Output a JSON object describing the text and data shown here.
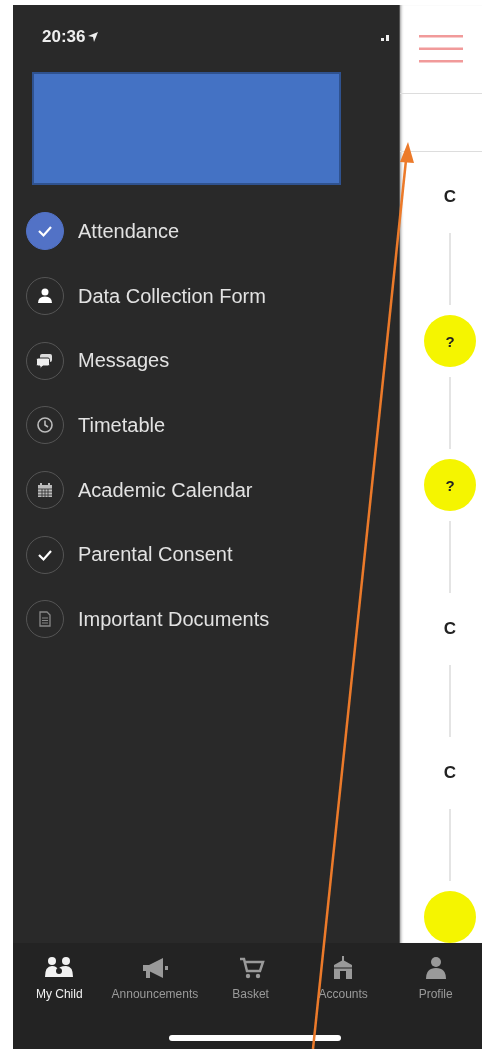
{
  "status_bar": {
    "time": "20:36"
  },
  "drawer": {
    "items": [
      {
        "label": "Attendance",
        "kind": "check",
        "selected": true
      },
      {
        "label": "Data Collection Form",
        "kind": "person",
        "selected": false
      },
      {
        "label": "Messages",
        "kind": "chat",
        "selected": false
      },
      {
        "label": "Timetable",
        "kind": "clock",
        "selected": false
      },
      {
        "label": "Academic Calendar",
        "kind": "calendar",
        "selected": false
      },
      {
        "label": "Parental Consent",
        "kind": "check",
        "selected": false
      },
      {
        "label": "Important Documents",
        "kind": "document",
        "selected": false
      }
    ]
  },
  "timeline": {
    "items": [
      {
        "kind": "letter",
        "label": "C"
      },
      {
        "kind": "unknown",
        "label": "?"
      },
      {
        "kind": "unknown",
        "label": "?"
      },
      {
        "kind": "letter",
        "label": "C"
      },
      {
        "kind": "letter",
        "label": "C"
      },
      {
        "kind": "unknown"
      }
    ]
  },
  "tab_bar": {
    "tabs": [
      {
        "label": "My Child",
        "kind": "family",
        "selected": true
      },
      {
        "label": "Announcements",
        "kind": "megaphone",
        "selected": false
      },
      {
        "label": "Basket",
        "kind": "cart",
        "selected": false
      },
      {
        "label": "Accounts",
        "kind": "building",
        "selected": false
      },
      {
        "label": "Profile",
        "kind": "person",
        "selected": false
      }
    ]
  }
}
